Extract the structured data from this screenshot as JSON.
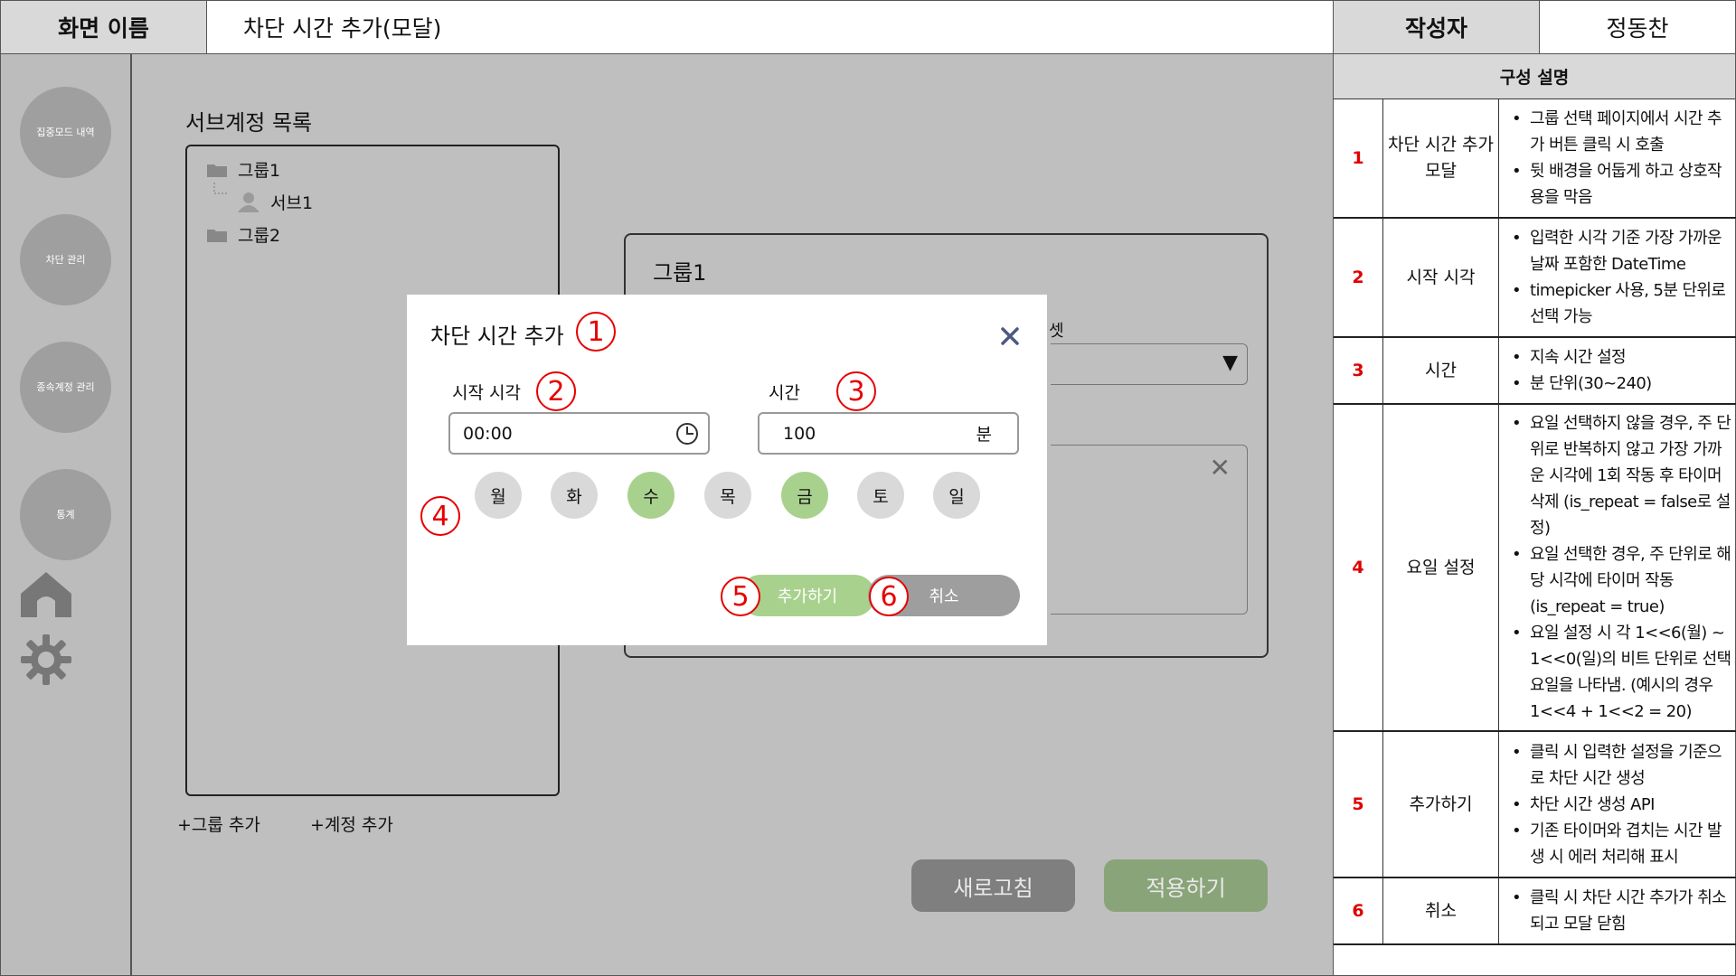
{
  "header": {
    "screen_name_label": "화면 이름",
    "screen_name_value": "차단 시간 추가(모달)",
    "author_label": "작성자",
    "author_value": "정동찬"
  },
  "sidebar": {
    "items": [
      {
        "label": "집중모드 내역"
      },
      {
        "label": "차단 관리"
      },
      {
        "label": "종속계정 관리"
      },
      {
        "label": "통계"
      }
    ],
    "icons": [
      "home-icon",
      "gear-icon"
    ]
  },
  "main": {
    "title": "서브계정 목록",
    "tree": [
      {
        "label": "그룹1",
        "type": "folder"
      },
      {
        "label": "서브1",
        "type": "user"
      },
      {
        "label": "그룹2",
        "type": "folder"
      }
    ],
    "add_group": "+그룹 추가",
    "add_account": "+계정 추가",
    "refresh_button": "새로고침",
    "apply_button": "적용하기"
  },
  "group_panel": {
    "title": "그룹1",
    "preset_fragment": "셋",
    "select_arrow": "▼",
    "close_glyph": "✕"
  },
  "modal": {
    "title": "차단 시간 추가",
    "start_time_label": "시작 시각",
    "start_time_value": "00:00",
    "duration_label": "시간",
    "duration_value": "100",
    "duration_unit": "분",
    "days": [
      {
        "label": "월",
        "selected": false
      },
      {
        "label": "화",
        "selected": false
      },
      {
        "label": "수",
        "selected": true
      },
      {
        "label": "목",
        "selected": false
      },
      {
        "label": "금",
        "selected": true
      },
      {
        "label": "토",
        "selected": false
      },
      {
        "label": "일",
        "selected": false
      }
    ],
    "add_button": "추가하기",
    "cancel_button": "취소"
  },
  "markers": [
    "1",
    "2",
    "3",
    "4",
    "5",
    "6"
  ],
  "spec": {
    "header": "구성 설명",
    "rows": [
      {
        "num": "1",
        "name": "차단 시간 추가 모달",
        "desc": [
          "그룹 선택 페이지에서 시간 추가 버튼 클릭 시 호출",
          "뒷 배경을 어둡게 하고 상호작용을 막음"
        ]
      },
      {
        "num": "2",
        "name": "시작 시각",
        "desc": [
          "입력한 시각 기준 가장 가까운 날짜 포함한 DateTime",
          "timepicker 사용, 5분 단위로 선택 가능"
        ]
      },
      {
        "num": "3",
        "name": "시간",
        "desc": [
          "지속 시간 설정",
          "분 단위(30~240)"
        ]
      },
      {
        "num": "4",
        "name": "요일 설정",
        "desc": [
          "요일 선택하지 않을 경우, 주 단위로 반복하지 않고 가장 가까운 시각에 1회 작동 후 타이머 삭제 (is_repeat = false로 설정)",
          "요일 선택한 경우, 주 단위로 해당 시각에 타이머 작동 (is_repeat = true)",
          "요일 설정 시 각 1<<6(월) ~ 1<<0(일)의 비트 단위로 선택 요일을 나타냄. (예시의 경우 1<<4 + 1<<2 = 20)"
        ]
      },
      {
        "num": "5",
        "name": "추가하기",
        "desc": [
          "클릭 시 입력한 설정을 기준으로 차단 시간 생성",
          "차단 시간 생성 API",
          "기존 타이머와 겹치는 시간 발생 시 에러 처리해 표시"
        ]
      },
      {
        "num": "6",
        "name": "취소",
        "desc": [
          "클릭 시 차단 시간 추가가 취소되고 모달 닫힘"
        ]
      }
    ]
  },
  "colors": {
    "overlay_gray": "#bfbfbf",
    "nav_circle": "#9f9f9f",
    "selected_day": "#a9d18e",
    "add_button": "#a9d18e",
    "cancel_button": "#9e9e9e",
    "apply_button": "#8aa47a",
    "refresh_button": "#7f7f7f",
    "marker_red": "#e60000"
  }
}
